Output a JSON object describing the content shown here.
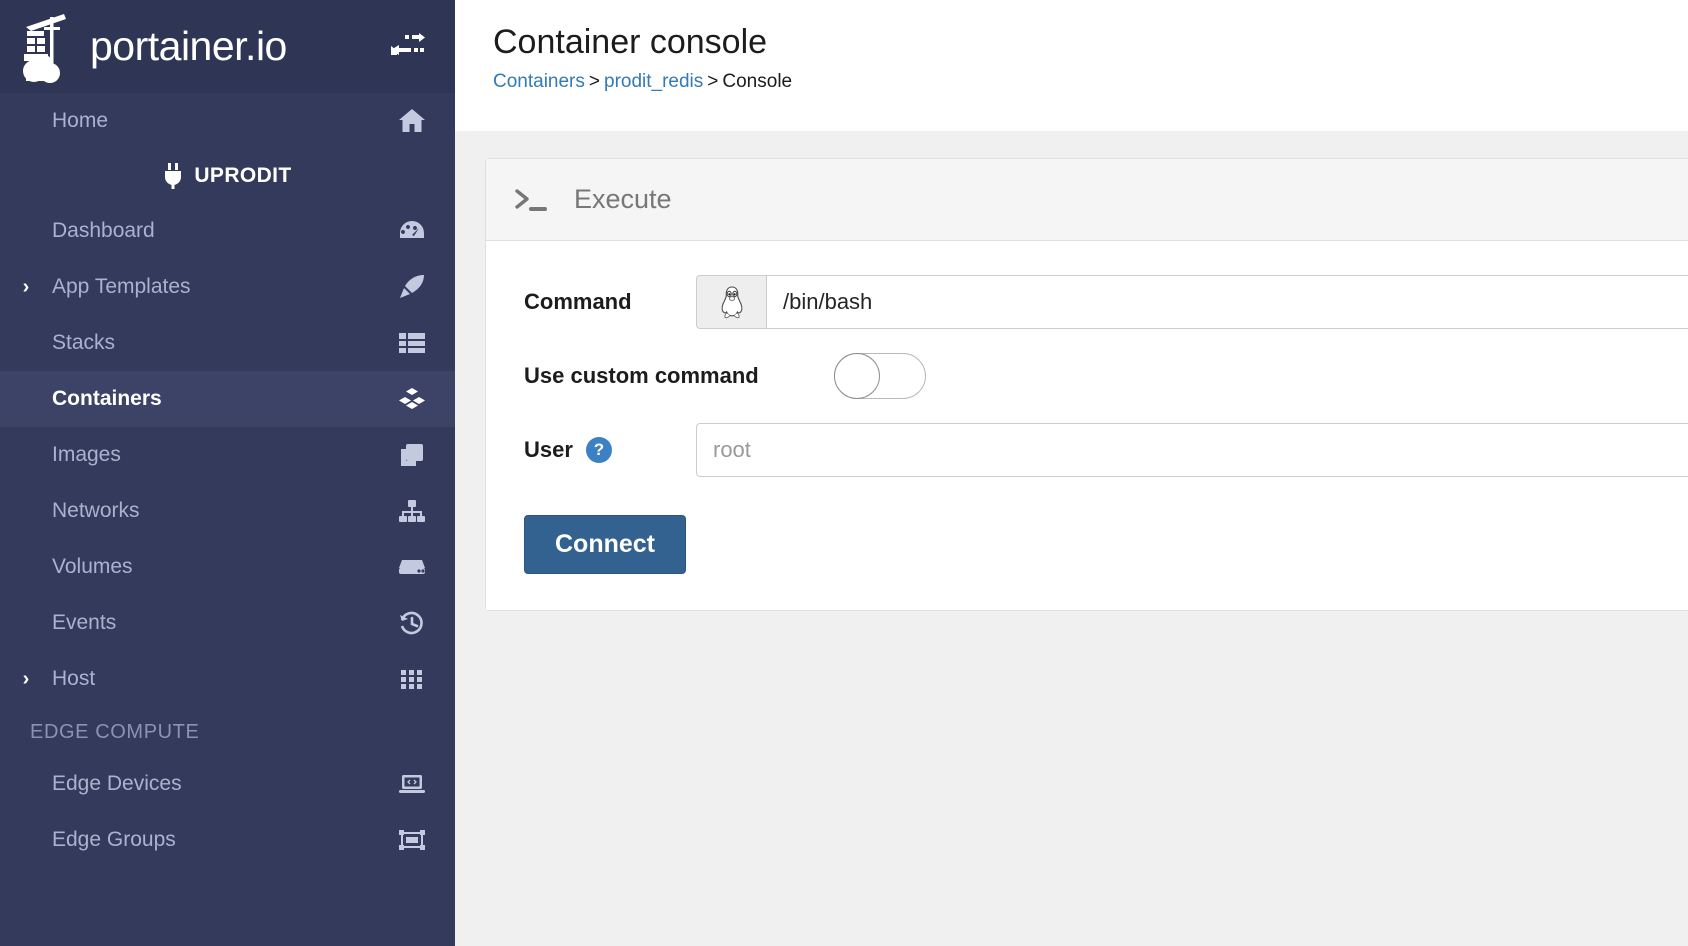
{
  "brand": {
    "name": "portainer.io",
    "logo_icon": "portainer-crane-logo",
    "toggle_icon": "sidebar-toggle-arrows-icon"
  },
  "sidebar": {
    "items": [
      {
        "label": "Home",
        "icon": "home-icon",
        "caret": "",
        "active": false
      },
      {
        "label": "Dashboard",
        "icon": "dashboard-gauge-icon",
        "caret": "",
        "active": false
      },
      {
        "label": "App Templates",
        "icon": "rocket-icon",
        "caret": "›",
        "active": false
      },
      {
        "label": "Stacks",
        "icon": "stacks-list-icon",
        "caret": "",
        "active": false
      },
      {
        "label": "Containers",
        "icon": "containers-boxes-icon",
        "caret": "",
        "active": true
      },
      {
        "label": "Images",
        "icon": "images-copy-icon",
        "caret": "",
        "active": false
      },
      {
        "label": "Networks",
        "icon": "networks-sitemap-icon",
        "caret": "",
        "active": false
      },
      {
        "label": "Volumes",
        "icon": "volumes-hdd-icon",
        "caret": "",
        "active": false
      },
      {
        "label": "Events",
        "icon": "events-history-icon",
        "caret": "",
        "active": false
      },
      {
        "label": "Host",
        "icon": "host-grid-icon",
        "caret": "›",
        "active": false
      }
    ],
    "endpoint": {
      "label": "UPRODIT",
      "icon": "plug-icon"
    },
    "section_title": "EDGE COMPUTE",
    "edge_items": [
      {
        "label": "Edge Devices",
        "icon": "edge-devices-laptop-code-icon"
      },
      {
        "label": "Edge Groups",
        "icon": "edge-groups-object-group-icon"
      }
    ]
  },
  "header": {
    "title": "Container console",
    "breadcrumb": {
      "first": "Containers",
      "second": "prodit_redis",
      "current": "Console",
      "separator": ">"
    }
  },
  "panel": {
    "title": "Execute",
    "icon": "terminal-prompt-icon"
  },
  "form": {
    "command": {
      "label": "Command",
      "addon_icon": "linux-tux-icon",
      "value": "/bin/bash",
      "placeholder": ""
    },
    "custom_command": {
      "label": "Use custom command",
      "state": "off"
    },
    "user": {
      "label": "User",
      "help_icon": "question-circle-icon",
      "help_glyph": "?",
      "value": "",
      "placeholder": "root"
    },
    "connect_button": "Connect"
  },
  "colors": {
    "sidebar_bg": "#343a5c",
    "sidebar_header_bg": "#2f3554",
    "sidebar_active_bg": "#3c4367",
    "accent_link": "#337ab7",
    "button_primary": "#336291",
    "help_badge": "#3c81c4",
    "page_bg": "#f0f0f0"
  }
}
